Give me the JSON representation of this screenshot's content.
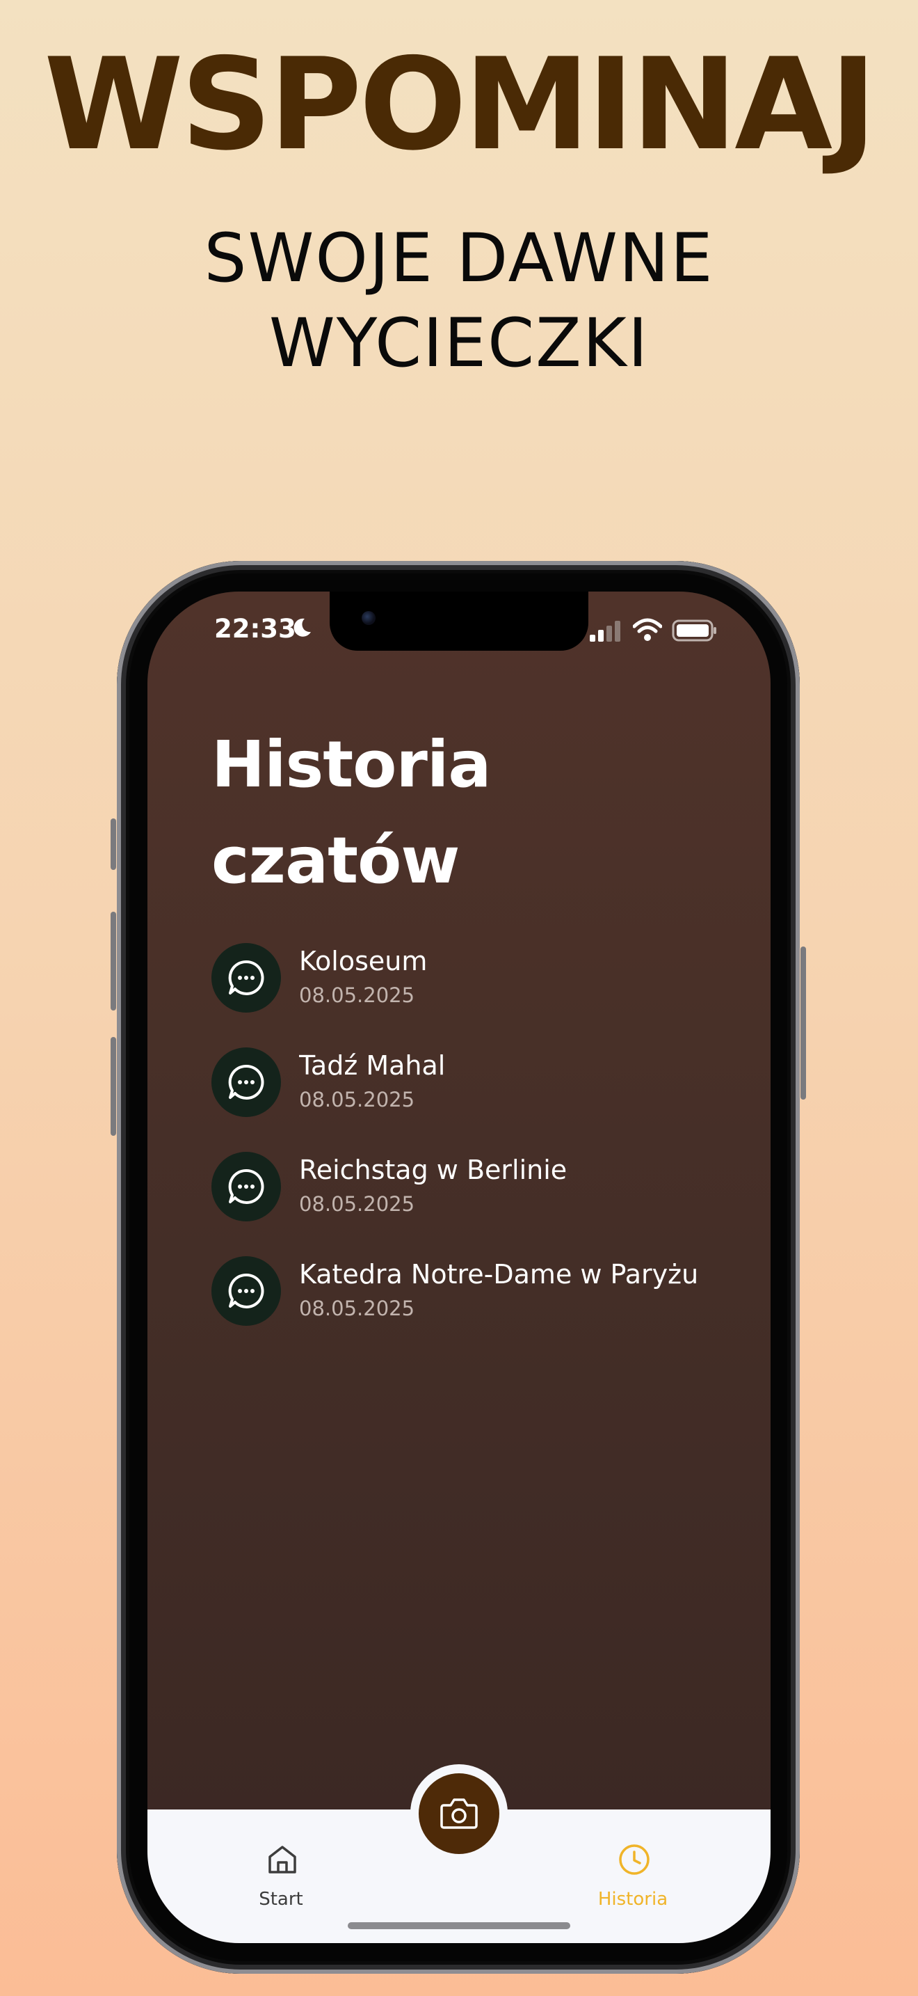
{
  "headline": "WSPOMINAJ",
  "subheadline": [
    "SWOJE DAWNE",
    "WYCIECZKI"
  ],
  "status_bar": {
    "time": "22:33"
  },
  "page": {
    "title_line1": "Historia",
    "title_line2": "czatów"
  },
  "chats": [
    {
      "title": "Koloseum",
      "date": "08.05.2025"
    },
    {
      "title": "Tadź Mahal",
      "date": "08.05.2025"
    },
    {
      "title": "Reichstag w Berlinie",
      "date": "08.05.2025"
    },
    {
      "title": "Katedra Notre-Dame w Paryżu",
      "date": "08.05.2025"
    }
  ],
  "tabbar": {
    "start_label": "Start",
    "history_label": "Historia",
    "active_tab": "history",
    "active_color": "#f0b429",
    "inactive_color": "#3d3d3d"
  },
  "icons": {
    "chat": "chat-bubble-dots-icon",
    "camera": "camera-icon",
    "home": "home-icon",
    "history": "clock-icon"
  },
  "colors": {
    "headline": "#4a2a05",
    "screen_bg": "#4a3029",
    "avatar_bg": "#14231b",
    "camera_button": "#4e2a08"
  }
}
